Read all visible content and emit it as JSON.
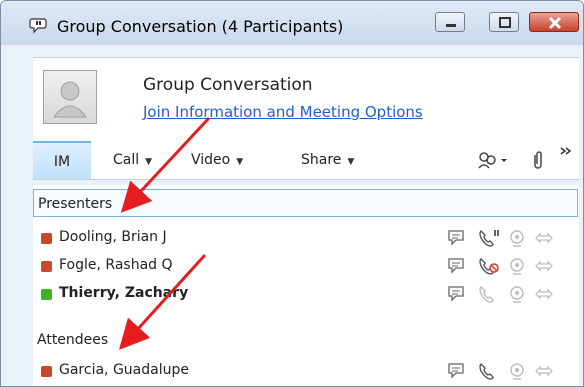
{
  "window": {
    "title": "Group Conversation (4 Participants)"
  },
  "header": {
    "title": "Group Conversation",
    "link_label": "Join Information and Meeting Options"
  },
  "tabs": [
    {
      "label": "IM"
    },
    {
      "label": "Call"
    },
    {
      "label": "Video"
    },
    {
      "label": "Share"
    }
  ],
  "groups": {
    "presenters": "Presenters",
    "attendees": "Attendees"
  },
  "participants": [
    {
      "name": "Dooling, Brian J",
      "status_color": "#c9482b"
    },
    {
      "name": "Fogle, Rashad Q",
      "status_color": "#c9482b"
    },
    {
      "name": "Thierry, Zachary",
      "status_color": "#43b02a"
    },
    {
      "name": "Garcia, Guadalupe",
      "status_color": "#c9482b"
    }
  ],
  "colors": {
    "accent": "#1d63c7",
    "arrow": "#e41e1e"
  },
  "icons": [
    "app-icon",
    "minimize-icon",
    "maximize-icon",
    "close-icon",
    "people-options-icon",
    "attachment-icon",
    "overflow-chevron-icon",
    "im-icon",
    "phone-icon",
    "video-icon",
    "transfer-icon"
  ]
}
